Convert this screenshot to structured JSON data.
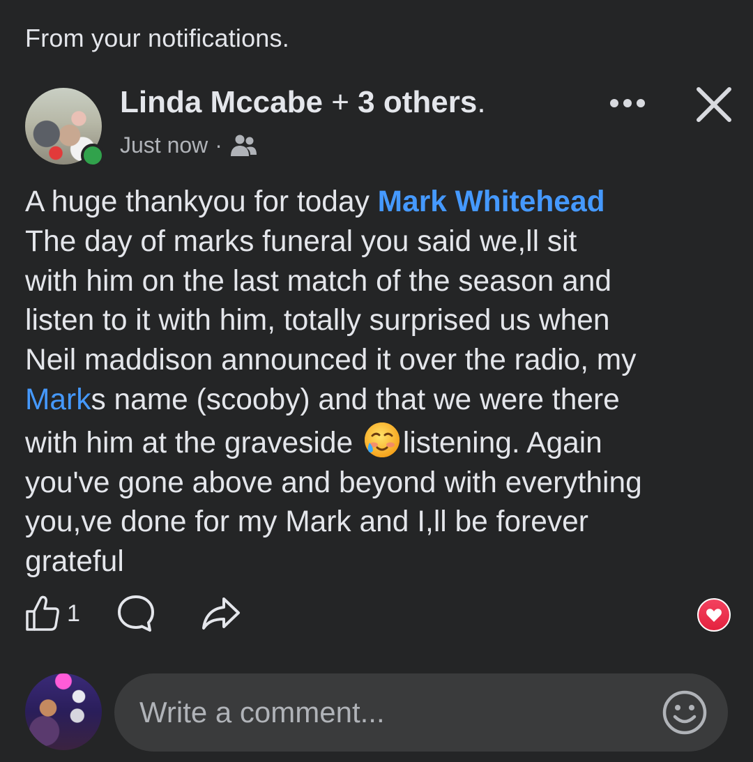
{
  "notification": {
    "label": "From your notifications."
  },
  "post": {
    "author_name": "Linda Mccabe",
    "plus": "+",
    "others": "3 others",
    "suffix": ".",
    "timestamp": "Just now",
    "separator": "·",
    "audience_icon": "friends-icon",
    "body_lines": [
      {
        "before": "A huge thankyou for today ",
        "mention": "Mark Whitehead",
        "after": ""
      },
      {
        "text": "The day of marks funeral you said we,ll sit"
      },
      {
        "text": "with him on the last match of the season and"
      },
      {
        "text": "listen to it with him, totally surprised us when"
      },
      {
        "text": "Neil maddison announced it over the radio, my"
      },
      {
        "link": "Mark",
        "after": "s name (scooby) and that we were there"
      },
      {
        "before": "with him at the graveside ",
        "emoji": "smiling-face-with-tear-emoji",
        "after": "listening. Again"
      },
      {
        "text": "you've gone above and beyond with everything"
      },
      {
        "text": "you,ve done for my Mark and I,ll be forever"
      },
      {
        "text": "grateful"
      }
    ]
  },
  "actions": {
    "like_count": "1",
    "like_icon": "thumbs-up-icon",
    "comment_icon": "comment-bubble-icon",
    "share_icon": "share-arrow-icon",
    "reaction_icon": "love-heart-icon"
  },
  "comment_bar": {
    "placeholder": "Write a comment...",
    "emoji_icon": "smiley-icon"
  },
  "colors": {
    "background": "#242526",
    "text": "#e4e6eb",
    "secondary_text": "#b0b3b8",
    "mention": "#4599ff",
    "online": "#31a24c",
    "love": "#f3425f",
    "input_bg": "#3a3b3c"
  }
}
